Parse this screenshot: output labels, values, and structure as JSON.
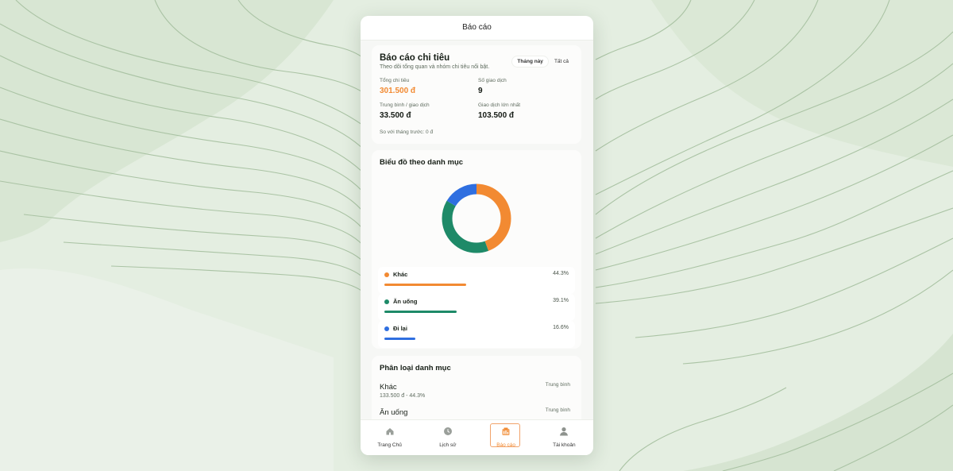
{
  "app": {
    "title": "Báo cáo"
  },
  "summary": {
    "title": "Báo cáo chi tiêu",
    "subtitle": "Theo dõi tổng quan và nhóm chi tiêu nổi bật.",
    "filters": [
      {
        "label": "Tháng này",
        "active": true
      },
      {
        "label": "Tất cả",
        "active": false
      }
    ],
    "stats": {
      "total_label": "Tổng chi tiêu",
      "total_value": "301.500 đ",
      "count_label": "Số giao dịch",
      "count_value": "9",
      "avg_label": "Trung bình / giao dịch",
      "avg_value": "33.500 đ",
      "max_label": "Giao dịch lớn nhất",
      "max_value": "103.500 đ"
    },
    "compare": "So với tháng trước: 0 đ"
  },
  "chart_section": {
    "title": "Biểu đồ theo danh mục",
    "chart_data": {
      "type": "pie",
      "style": "donut",
      "categories": [
        "Khác",
        "Ăn uống",
        "Đi lại"
      ],
      "values": [
        44.3,
        39.1,
        16.6
      ],
      "labels": [
        "44.3%",
        "39.1%",
        "16.6%"
      ],
      "colors": [
        "#f28a32",
        "#1e8a68",
        "#2f6fe0"
      ]
    }
  },
  "categories_section": {
    "title": "Phân loại danh mục",
    "items": [
      {
        "name": "Khác",
        "tag": "Trung bình",
        "detail": "133.500 đ - 44.3%"
      },
      {
        "name": "Ăn uống",
        "tag": "Trung bình",
        "detail": ""
      }
    ]
  },
  "nav": [
    {
      "label": "Trang Chủ",
      "icon": "home-icon"
    },
    {
      "label": "Lịch sử",
      "icon": "clock-icon"
    },
    {
      "label": "Báo cáo",
      "icon": "report-icon",
      "active": true
    },
    {
      "label": "Tài khoản",
      "icon": "user-icon"
    }
  ],
  "colors": {
    "accent": "#f28a32",
    "background": "#e4eee1"
  }
}
